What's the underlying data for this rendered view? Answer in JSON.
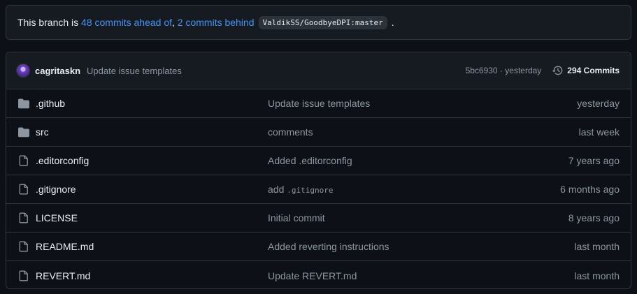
{
  "banner": {
    "prefix": "This branch is",
    "ahead_link": "48 commits ahead of",
    "comma": ",",
    "behind_link": "2 commits behind",
    "upstream_ref": "ValdikSS/GoodbyeDPI:master",
    "suffix": "."
  },
  "latest_commit": {
    "author": "cagritaskn",
    "message": "Update issue templates",
    "sha_time": "5bc6930 · yesterday",
    "commits_count": "294 Commits"
  },
  "files": [
    {
      "type": "folder",
      "name": ".github",
      "commit": "Update issue templates",
      "age": "yesterday"
    },
    {
      "type": "folder",
      "name": "src",
      "commit": "comments",
      "age": "last week"
    },
    {
      "type": "file",
      "name": ".editorconfig",
      "commit": "Added .editorconfig",
      "age": "7 years ago"
    },
    {
      "type": "file",
      "name": ".gitignore",
      "commit_prefix": "add",
      "commit_code": ".gitignore",
      "age": "6 months ago"
    },
    {
      "type": "file",
      "name": "LICENSE",
      "commit": "Initial commit",
      "age": "8 years ago"
    },
    {
      "type": "file",
      "name": "README.md",
      "commit": "Added reverting instructions",
      "age": "last month"
    },
    {
      "type": "file",
      "name": "REVERT.md",
      "commit": "Update REVERT.md",
      "age": "last month"
    }
  ],
  "colors": {
    "background": "#0d1117",
    "panel": "#161b22",
    "border": "#30363d",
    "link": "#4493f8",
    "muted_text": "#8d96a0",
    "icon": "#8d96a0"
  }
}
